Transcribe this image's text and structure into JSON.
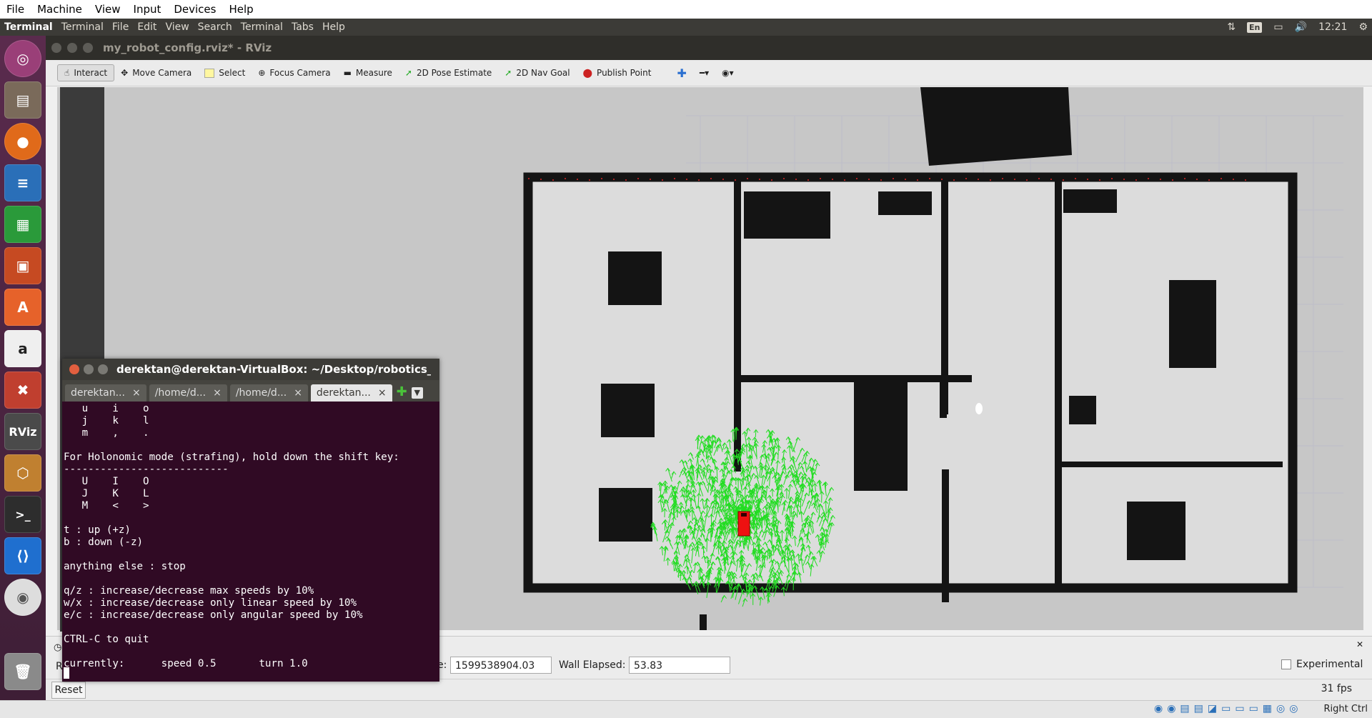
{
  "vbox_menu": [
    "File",
    "Machine",
    "View",
    "Input",
    "Devices",
    "Help"
  ],
  "topbar": {
    "app_name": "Terminal",
    "menus": [
      "Terminal",
      "File",
      "Edit",
      "View",
      "Search",
      "Terminal",
      "Tabs",
      "Help"
    ],
    "lang": "En",
    "time": "12:21"
  },
  "rviz": {
    "window_title": "my_robot_config.rviz* - RViz",
    "tools": {
      "interact": "Interact",
      "move_camera": "Move Camera",
      "select": "Select",
      "focus_camera": "Focus Camera",
      "measure": "Measure",
      "pose_estimate": "2D Pose Estimate",
      "nav_goal": "2D Nav Goal",
      "publish_point": "Publish Point"
    },
    "time_panel": {
      "ros_time_label_partial": "e:",
      "ros_time_value": "1599538904.03",
      "wall_elapsed_label": "Wall Elapsed:",
      "wall_elapsed_value": "53.83",
      "experimental_label": "Experimental",
      "reset_label": "Reset",
      "fps": "31 fps",
      "left_char": "R"
    }
  },
  "terminal": {
    "title": "derektan@derektan-VirtualBox: ~/Desktop/robotics_softwar",
    "tabs": [
      "derektan...",
      "/home/d...",
      "/home/d...",
      "derektan..."
    ],
    "active_tab": 3,
    "lines": [
      "   u    i    o",
      "   j    k    l",
      "   m    ,    .",
      "",
      "For Holonomic mode (strafing), hold down the shift key:",
      "---------------------------",
      "   U    I    O",
      "   J    K    L",
      "   M    <    >",
      "",
      "t : up (+z)",
      "b : down (-z)",
      "",
      "anything else : stop",
      "",
      "q/z : increase/decrease max speeds by 10%",
      "w/x : increase/decrease only linear speed by 10%",
      "e/c : increase/decrease only angular speed by 10%",
      "",
      "CTRL-C to quit",
      "",
      "currently:      speed 0.5       turn 1.0"
    ]
  },
  "launcher": [
    "ubuntu",
    "files",
    "firefox",
    "writer",
    "calc",
    "impress",
    "software",
    "amazon",
    "settings",
    "RViz",
    "box",
    "terminal",
    "vscode",
    "dvd",
    "trash"
  ],
  "launcher_text": {
    "rviz": "RViz"
  },
  "vbox_status": {
    "right_ctrl": "Right Ctrl"
  },
  "colors": {
    "particles": "#22dd22",
    "robot": "#ee1111",
    "map_free": "#dcdcdc",
    "map_unknown": "#c7c7c7",
    "occupied": "#141414",
    "terminal_bg": "#300a24"
  }
}
